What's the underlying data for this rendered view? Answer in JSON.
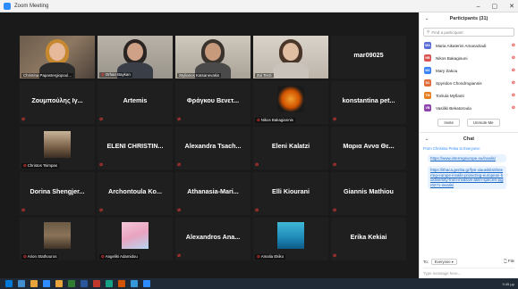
{
  "window": {
    "title": "Zoom Meeting",
    "minimize": "–",
    "maximize": "▢",
    "close": "✕"
  },
  "tiles": [
    {
      "type": "video",
      "caption": "Christina Papastergiopoul...",
      "muted": false,
      "active": false,
      "variant": "v1"
    },
    {
      "type": "video",
      "caption": "Orhan Baykan",
      "muted": true,
      "active": false,
      "variant": "v2"
    },
    {
      "type": "video",
      "caption": "Stylianos Katsanevakis",
      "muted": false,
      "active": true,
      "variant": "v3"
    },
    {
      "type": "video",
      "caption": "Zoi Terzi",
      "muted": false,
      "active": false,
      "variant": "v4"
    },
    {
      "type": "name",
      "label": "mar09025",
      "muted": false
    },
    {
      "type": "name",
      "label": "Ζουμπούλης Ιγ...",
      "muted": true
    },
    {
      "type": "name",
      "label": "Artemis",
      "muted": true
    },
    {
      "type": "name",
      "label": "Φράγκου Βενετ...",
      "muted": true
    },
    {
      "type": "image",
      "caption": "Nikos Bakagiannis",
      "muted": true
    },
    {
      "type": "name",
      "label": "konstantina pet...",
      "muted": true
    },
    {
      "type": "photo",
      "caption": "Christos Tsimpas",
      "muted": true
    },
    {
      "type": "name",
      "label": "ELENI CHRISTIN...",
      "muted": true
    },
    {
      "type": "name",
      "label": "Alexandra Tsach...",
      "muted": true
    },
    {
      "type": "name",
      "label": "Eleni Kalatzi",
      "muted": true
    },
    {
      "type": "name",
      "label": "Μαρια Αννα Θε...",
      "muted": true
    },
    {
      "type": "name",
      "label": "Dorina Shengjer...",
      "muted": true
    },
    {
      "type": "name",
      "label": "Archontoula Ko...",
      "muted": true
    },
    {
      "type": "name",
      "label": "Athanasia-Mari...",
      "muted": true
    },
    {
      "type": "name",
      "label": "Elli Kiourani",
      "muted": true
    },
    {
      "type": "name",
      "label": "Giannis Mathiou",
      "muted": true
    },
    {
      "type": "photo2",
      "caption": "Arion Stathouros",
      "muted": true
    },
    {
      "type": "photo3",
      "caption": "Angeliki Adamidou",
      "muted": true
    },
    {
      "type": "name",
      "label": "Alexandros Ana...",
      "muted": true
    },
    {
      "type": "sea",
      "caption": "Amalia Ekiko",
      "muted": true
    },
    {
      "type": "name",
      "label": "Erika Kekiai",
      "muted": true
    }
  ],
  "participants": {
    "title": "Participants (31)",
    "search_placeholder": "Find a participant",
    "items": [
      {
        "initials": "MA",
        "name": "Maria Aikaterini Amanaziadi",
        "color": "#5b6fd6"
      },
      {
        "initials": "NB",
        "name": "Nikos Bakagiouni",
        "color": "#d9534f"
      },
      {
        "initials": "MZ",
        "name": "Mary Zakou",
        "color": "#3b82f6"
      },
      {
        "initials": "SC",
        "name": "Spyridon Chondrogiannis",
        "color": "#e06c3c"
      },
      {
        "initials": "TM",
        "name": "Tonlula Myfianti",
        "color": "#e67e22"
      },
      {
        "initials": "VB",
        "name": "Vasiliki Bekatoroula",
        "color": "#8e44ad"
      }
    ],
    "invite": "Invite",
    "unmute_me": "Unmute Me"
  },
  "chat": {
    "title": "Chat",
    "from": "From Christina Petsa to Everyone:",
    "messages": [
      "https://www.interregeurope.eu/invalis/",
      "https://ithaca.genba.gr/fysi-xiaoeiklisit/interreg-europe-invalis-protecting-european-biodiversity-from-invasive-alien-species-pgjr0271-invalis/"
    ],
    "to_label": "To:",
    "to_value": "Everyone ▾",
    "file": "File",
    "placeholder": "Type message here..."
  },
  "taskbar": {
    "icons": [
      "#0078d7",
      "#3e8ed0",
      "#e8a33d",
      "#2d8cff",
      "#e8a33d",
      "#2e7d32",
      "#2b579a",
      "#c0392b",
      "#16a085",
      "#d35400",
      "#3498db",
      "#2d8cff"
    ],
    "tray_time": "9:45 μμ"
  }
}
